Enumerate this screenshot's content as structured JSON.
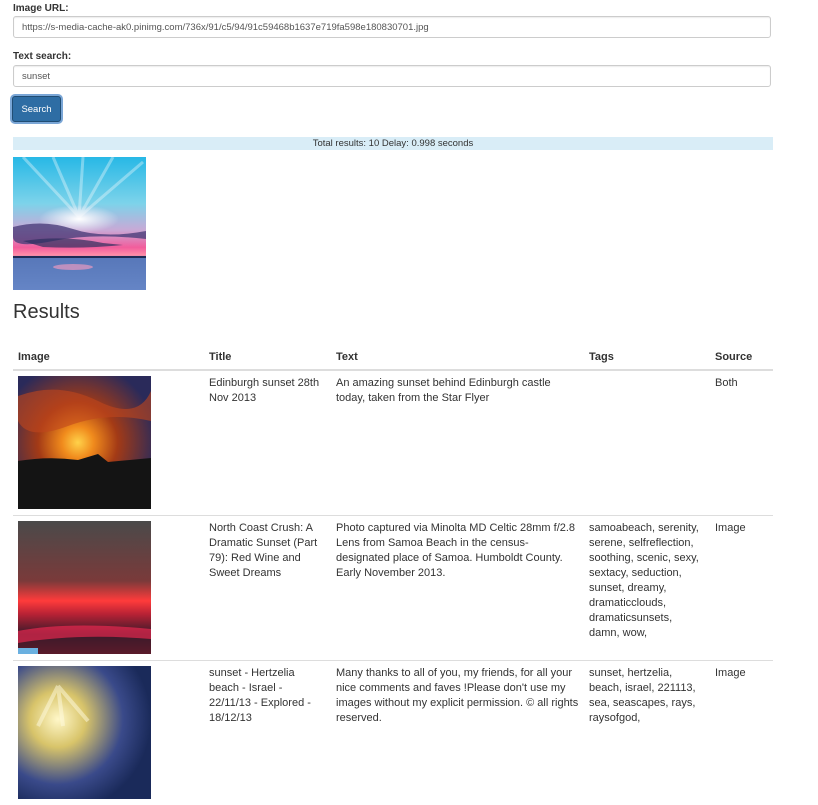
{
  "form": {
    "image_url_label": "Image URL:",
    "image_url_value": "https://s-media-cache-ak0.pinimg.com/736x/91/c5/94/91c59468b1637e719fa598e180830701.jpg",
    "text_search_label": "Text search:",
    "text_search_value": "sunset",
    "search_button": "Search"
  },
  "status": "Total results: 10 Delay: 0.998 seconds",
  "results": {
    "heading": "Results",
    "columns": [
      "Image",
      "Title",
      "Text",
      "Tags",
      "Source"
    ],
    "rows": [
      {
        "title": "Edinburgh sunset 28th Nov 2013",
        "text": "An amazing sunset behind Edinburgh castle today, taken from the Star Flyer",
        "tags": "",
        "source": "Both"
      },
      {
        "title": "North Coast Crush: A Dramatic Sunset (Part 79): Red Wine and Sweet Dreams",
        "text": "Photo captured via Minolta MD Celtic 28mm f/2.8 Lens from Samoa Beach in the census-designated place of Samoa. Humboldt County. Early November 2013.",
        "tags": "samoabeach, serenity, serene, selfreflection, soothing, scenic, sexy, sextacy, seduction, sunset, dreamy, dramaticclouds, dramaticsunsets, damn, wow,",
        "source": "Image"
      },
      {
        "title": "sunset - Hertzelia beach - Israel - 22/11/13 - Explored - 18/12/13",
        "text": "Many thanks to all of you, my friends, for all your nice comments and faves !Please don't use my images without my explicit permission. © all rights reserved.",
        "tags": "sunset, hertzelia, beach, israel, 221113, sea, seascapes, rays, raysofgod,",
        "source": "Image"
      }
    ]
  }
}
